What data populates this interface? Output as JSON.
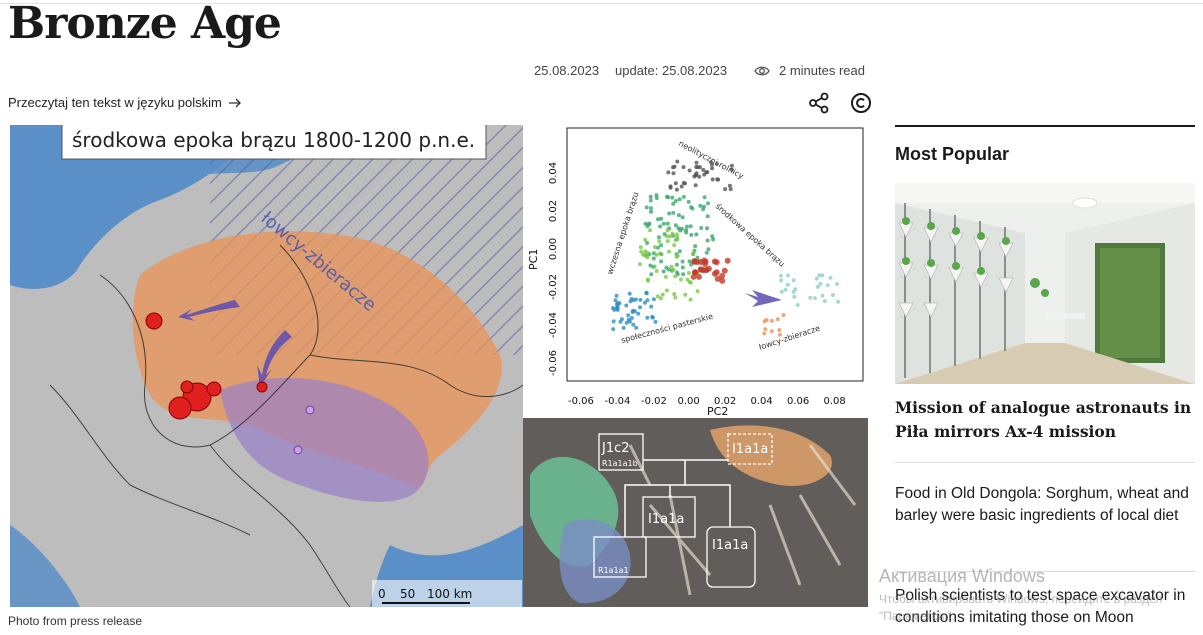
{
  "article": {
    "title": "Bronze Age",
    "date": "25.08.2023",
    "update": "update: 25.08.2023",
    "read_time": "2 minutes read",
    "language_link": "Przeczytaj ten tekst w języku polskim",
    "caption": "Photo from press release"
  },
  "figure": {
    "map_title": "środkowa epoka brązu 1800-1200 p.n.e.",
    "map_label_hunters": "łowcy-zbieracze",
    "scale_0": "0",
    "scale_50": "50",
    "scale_100": "100 km",
    "pca": {
      "ylabel": "PC1",
      "xlabel": "PC2",
      "x_ticks": [
        "-0.06",
        "-0.04",
        "-0.02",
        "0.00",
        "0.02",
        "0.04",
        "0.06",
        "0.08"
      ],
      "y_ticks": [
        "0.04",
        "0.02",
        "0.00",
        "-0.02",
        "-0.04",
        "-0.06"
      ],
      "label_farmers": "neolityczni rolnicy",
      "label_early_bronze": "wczesna epoka brązu",
      "label_middle_bronze": "środkowa epoka brązu",
      "label_herders": "społeczności pasterskie",
      "label_hunters": "łowcy-zbieracze"
    },
    "burial": {
      "label_j1c2": "J1c2",
      "label_r1a1a1b": "R1a1a1b",
      "label_i1a1a_1": "I1a1a",
      "label_i1a1a_2": "I1a1a",
      "label_i1a1a_3": "I1a1a",
      "label_r1a1a1": "R1a1a1"
    }
  },
  "sidebar": {
    "heading": "Most Popular",
    "items": [
      {
        "title": "Mission of analogue astronauts in Piła mirrors Ax-4 mission"
      },
      {
        "title": "Food in Old Dongola: Sorghum, wheat and barley were basic ingredients of local diet"
      },
      {
        "title": "Polish scientists to test space excavator in conditions imitating those on Moon"
      }
    ]
  },
  "overlay": {
    "activation_title": "Активация Windows",
    "activation_sub": "Чтобы активировать Windows, перейдите в раздел \"Параметры\"."
  },
  "colors": {
    "text": "#1a1a1a",
    "sea": "#5b8fc7",
    "land": "#c8c8c8",
    "orange_region": "#e8935a",
    "purple_region": "#9a7fc8",
    "red_sites": "#e02020"
  }
}
